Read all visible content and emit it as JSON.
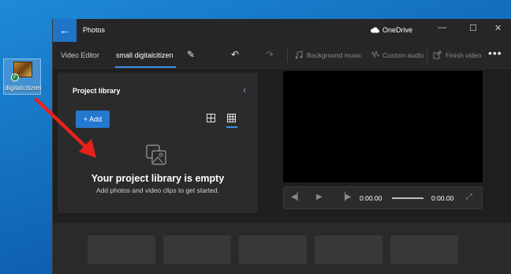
{
  "desktop": {
    "icon_label": "digitalcitizen"
  },
  "titlebar": {
    "back_glyph": "←",
    "app_title": "Photos",
    "onedrive_label": "OneDrive",
    "minimize_glyph": "—",
    "maximize_glyph": "☐",
    "close_glyph": "✕"
  },
  "toolbar": {
    "breadcrumb_root": "Video Editor",
    "project_name": "small digitalcitizen",
    "rename_glyph": "✎",
    "undo_glyph": "↶",
    "redo_glyph": "↷",
    "background_music": "Background music",
    "custom_audio": "Custom audio",
    "finish_video": "Finish video",
    "more_glyph": "•••"
  },
  "library": {
    "title": "Project library",
    "collapse_glyph": "‹",
    "add_label": "+ Add",
    "empty_title": "Your project library is empty",
    "empty_subtitle": "Add photos and video clips to get started."
  },
  "player": {
    "current_time": "0:00.00",
    "total_time": "0:00.00"
  },
  "colors": {
    "accent": "#1f74c9",
    "window_bg": "#1f1f1f",
    "panel_bg": "#2b2b2b",
    "arrow": "#e8221b"
  },
  "icons": [
    "back-arrow-icon",
    "cloud-icon",
    "pencil-icon",
    "undo-icon",
    "redo-icon",
    "music-icon",
    "audio-icon",
    "export-icon",
    "more-icon",
    "grid-large-icon",
    "grid-small-icon",
    "photos-icon",
    "skip-back-icon",
    "play-icon",
    "skip-forward-icon",
    "fullscreen-icon"
  ]
}
